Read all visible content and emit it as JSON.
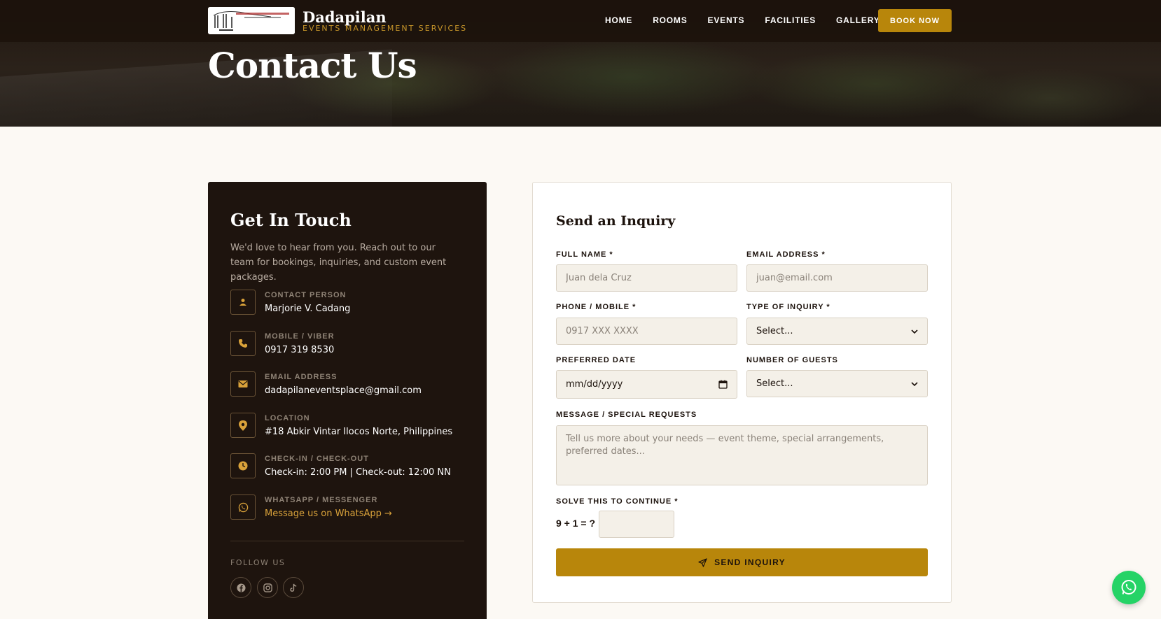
{
  "brand": {
    "name": "Dadapilan",
    "tagline": "EVENTS MANAGEMENT SERVICES",
    "logo_text": "DADAPILAN EVENT SERVICES"
  },
  "nav": {
    "links": [
      "HOME",
      "ROOMS",
      "EVENTS",
      "FACILITIES",
      "GALLERY"
    ],
    "book_label": "BOOK NOW"
  },
  "hero": {
    "title": "Contact Us"
  },
  "contact": {
    "title": "Get In Touch",
    "intro": "We'd love to hear from you. Reach out to our team for bookings, inquiries, and custom event packages.",
    "items": [
      {
        "icon": "person-icon",
        "label": "CONTACT PERSON",
        "value": "Marjorie V. Cadang"
      },
      {
        "icon": "phone-icon",
        "label": "MOBILE / VIBER",
        "value": "0917 319 8530"
      },
      {
        "icon": "envelope-icon",
        "label": "EMAIL ADDRESS",
        "value": "dadapilaneventsplace@gmail.com"
      },
      {
        "icon": "location-pin-icon",
        "label": "LOCATION",
        "value": "#18 Abkir Vintar Ilocos Norte, Philippines"
      },
      {
        "icon": "clock-icon",
        "label": "CHECK-IN / CHECK-OUT",
        "value": "Check-in: 2:00 PM  |  Check-out: 12:00 NN"
      },
      {
        "icon": "whatsapp-icon",
        "label": "WHATSAPP / MESSENGER",
        "value": "Message us on WhatsApp →"
      }
    ],
    "follow_label": "FOLLOW US",
    "socials": [
      "facebook-icon",
      "instagram-icon",
      "tiktok-icon"
    ]
  },
  "form": {
    "title": "Send an Inquiry",
    "full_name": {
      "label": "FULL NAME *",
      "placeholder": "Juan dela Cruz"
    },
    "email": {
      "label": "EMAIL ADDRESS *",
      "placeholder": "juan@email.com"
    },
    "phone": {
      "label": "PHONE / MOBILE *",
      "placeholder": "0917 XXX XXXX"
    },
    "inquiry_type": {
      "label": "TYPE OF INQUIRY *",
      "selected": "Select..."
    },
    "date": {
      "label": "PREFERRED DATE",
      "placeholder": "mm/dd/yyyy"
    },
    "guests": {
      "label": "NUMBER OF GUESTS",
      "selected": "Select..."
    },
    "message": {
      "label": "MESSAGE / SPECIAL REQUESTS",
      "placeholder": "Tell us more about your needs — event theme, special arrangements, preferred dates..."
    },
    "captcha": {
      "label": "SOLVE THIS TO CONTINUE *",
      "question": "9 + 1 = ?"
    },
    "submit_label": "SEND INQUIRY"
  },
  "colors": {
    "dark": "#1e140e",
    "gold": "#b8860b",
    "accent_text": "#d9a23a",
    "whatsapp": "#25d366",
    "page_bg": "#fcf9f4"
  }
}
